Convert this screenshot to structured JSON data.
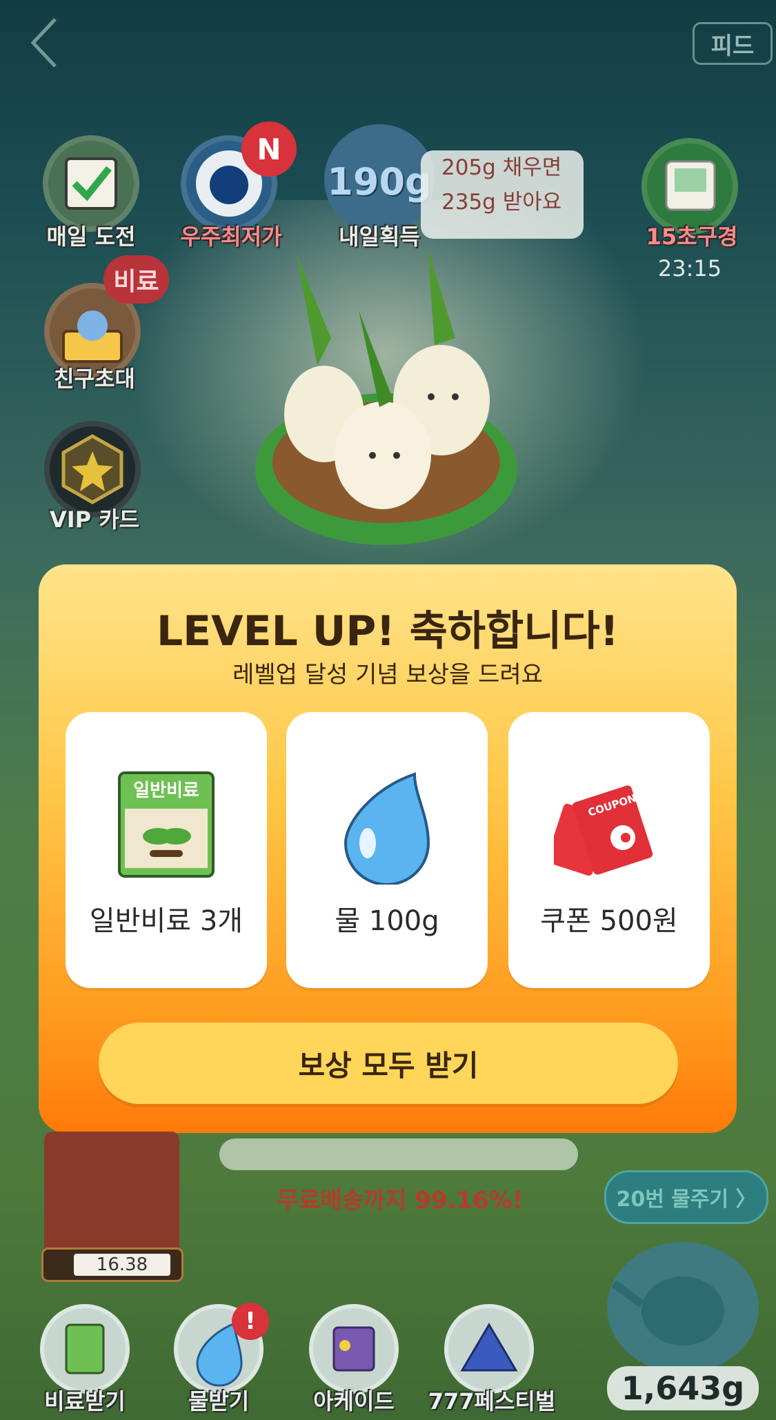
{
  "header": {
    "feed_label": "피드"
  },
  "top_icons": [
    {
      "label": "매일 도전"
    },
    {
      "label": "우주최저가",
      "badge": "N"
    },
    {
      "label": "내일획득"
    },
    {
      "label": "15초구경",
      "timer": "23:15"
    }
  ],
  "tomorrow": {
    "value": "190g",
    "line1": "205g 채우면",
    "line2": "235g 받아요"
  },
  "side_icons": [
    {
      "label": "친구초대",
      "tag": "비료"
    },
    {
      "label": "VIP 카드"
    }
  ],
  "modal": {
    "title": "LEVEL UP! 축하합니다!",
    "subtitle": "레벨업 달성 기념 보상을 드려요",
    "rewards": [
      {
        "icon": "fertilizer-bag-icon",
        "bag_text": "일반비료",
        "label": "일반비료 3개"
      },
      {
        "icon": "water-drop-icon",
        "label": "물 100g"
      },
      {
        "icon": "coupon-icon",
        "coupon_text": "COUPON",
        "label": "쿠폰 500원"
      }
    ],
    "button_label": "보상 모두 받기"
  },
  "game": {
    "progress_text": "무료배송까지 99.16%!",
    "water_button": "20번 물주기 〉",
    "water_level": "16.38",
    "total_weight": "1,643g"
  },
  "bottom_nav": [
    {
      "label": "비료받기"
    },
    {
      "label": "물받기",
      "alert": "!"
    },
    {
      "label": "아케이드"
    },
    {
      "label": "777페스티벌"
    }
  ],
  "colors": {
    "modal_top": "#ffe48a",
    "modal_bottom": "#ff7a0a",
    "button": "#ffd659",
    "badge_red": "#d8323a"
  }
}
